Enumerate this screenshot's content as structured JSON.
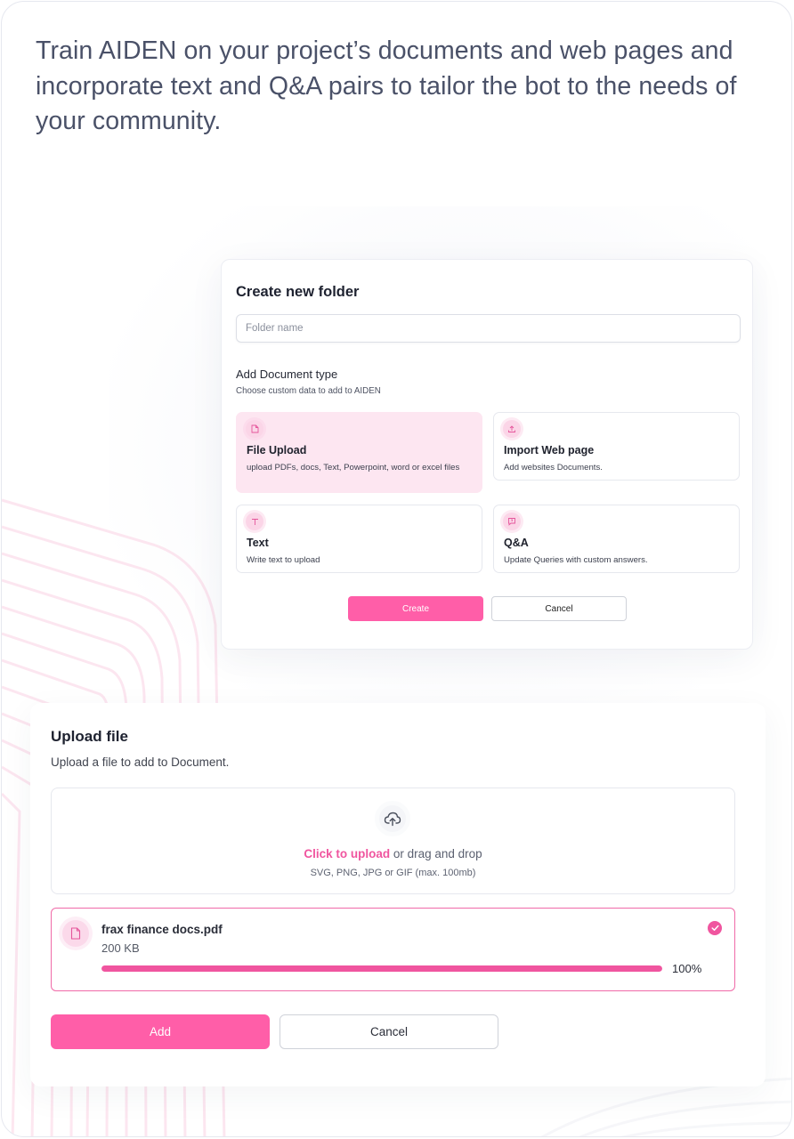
{
  "headline": "Train AIDEN on your project’s documents and web pages and incorporate text and Q&A pairs to tailor the bot to the needs of your community.",
  "create_folder": {
    "title": "Create new folder",
    "folder_name_placeholder": "Folder name",
    "doc_type_title": "Add Document type",
    "doc_type_subtitle": "Choose custom data to add to AIDEN",
    "options": [
      {
        "title": "File Upload",
        "description": "upload PDFs, docs, Text, Powerpoint, word or excel files",
        "icon": "file-icon",
        "selected": true
      },
      {
        "title": "Import Web page",
        "description": "Add websites Documents.",
        "icon": "upload-tray-icon",
        "selected": false
      },
      {
        "title": "Text",
        "description": "Write text to upload",
        "icon": "text-t-icon",
        "selected": false
      },
      {
        "title": "Q&A",
        "description": "Update Queries with custom answers.",
        "icon": "chat-question-icon",
        "selected": false
      }
    ],
    "create_label": "Create",
    "cancel_label": "Cancel"
  },
  "upload": {
    "title": "Upload file",
    "subtitle": "Upload a file to add to Document.",
    "click_to_upload": "Click to upload",
    "drag_text": " or drag and drop",
    "hint": "SVG, PNG, JPG or GIF (max. 100mb)",
    "file": {
      "name": "frax finance docs.pdf",
      "size": "200 KB",
      "progress": 100,
      "progress_label": "100%"
    },
    "add_label": "Add",
    "cancel_label": "Cancel"
  },
  "colors": {
    "accent": "#ff5ea8",
    "accent_dark": "#f0559f",
    "selected_bg": "#fde6f1"
  }
}
